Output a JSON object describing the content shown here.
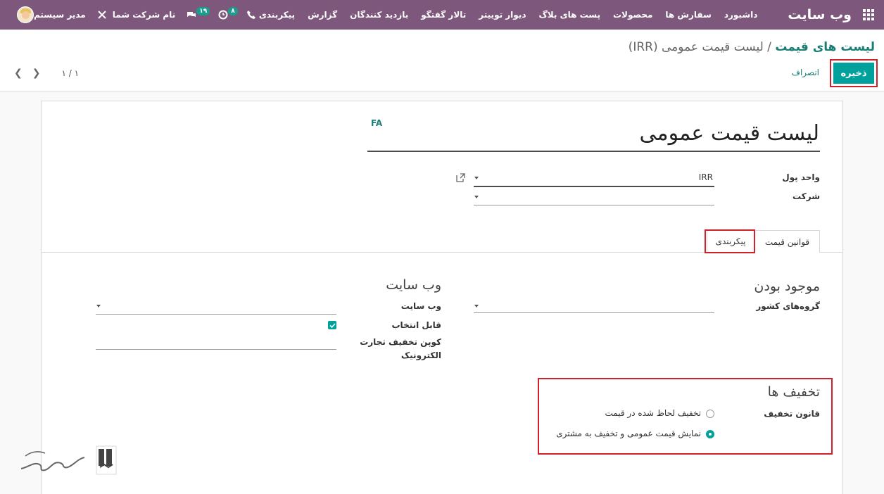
{
  "navbar": {
    "brand": "وب سایت",
    "menu": [
      "داشبورد",
      "سفارش ها",
      "محصولات",
      "پست های بلاگ",
      "دیوار توییتر",
      "تالار گفتگو",
      "بازدید کنندگان",
      "گزارش",
      "پیکربندی"
    ],
    "company": "نام شرکت شما",
    "user": "مدیر سیستم",
    "messages_count": "۱۹",
    "activities_count": "۸"
  },
  "control_panel": {
    "breadcrumb_parent": "لیست های قیمت",
    "breadcrumb_sep": " / ",
    "breadcrumb_current": "لیست قیمت عمومی (IRR)",
    "save_label": "ذخیره",
    "discard_label": "انصراف",
    "pager": "۱ / ۱"
  },
  "form": {
    "title": "لیست قیمت عمومی",
    "lang": "FA",
    "currency_label": "واحد پول",
    "currency_value": "IRR",
    "company_label": "شرکت",
    "company_value": ""
  },
  "tabs": {
    "rules": "قوانین قیمت",
    "config": "پیکربندی"
  },
  "availability": {
    "title": "موجود بودن",
    "country_groups_label": "گروه‌های کشور"
  },
  "website": {
    "title": "وب سایت",
    "website_label": "وب سایت",
    "selectable_label": "قابل انتخاب",
    "selectable_checked": true,
    "coupon_label_1": "کوپن تخفیف تجارت",
    "coupon_label_2": "الکترونیک"
  },
  "discounts": {
    "title": "تخفیف ها",
    "rule_label": "قانون تخفیف",
    "option_included": "تخفیف لحاظ شده در قیمت",
    "option_show": "نمایش قیمت عمومی و تخفیف به مشتری",
    "selected": "option_show"
  },
  "colors": {
    "navbar": "#7e577c",
    "primary": "#00a09d",
    "link": "#1a7e74",
    "highlight": "#d0202c"
  },
  "icons": [
    "apps-grid-icon",
    "phone-icon",
    "clock-icon",
    "chat-icon",
    "tools-icon",
    "external-link-icon",
    "check-icon",
    "chevron-left-icon",
    "chevron-right-icon"
  ]
}
